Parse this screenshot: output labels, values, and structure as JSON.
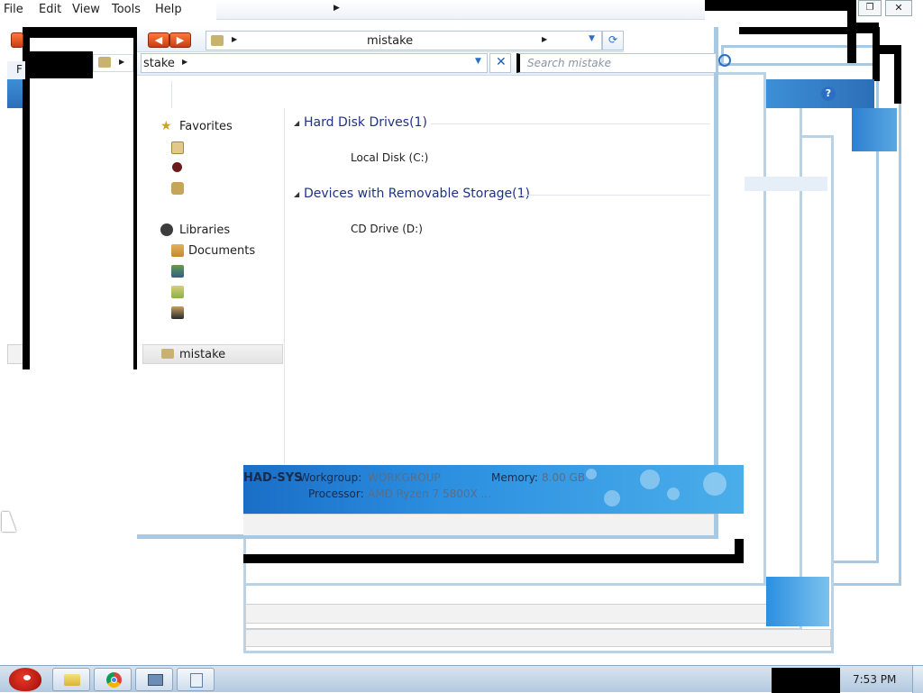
{
  "menu": {
    "file": "File",
    "edit": "Edit",
    "view": "View",
    "tools": "Tools",
    "help": "Help"
  },
  "address": {
    "current": "mistake",
    "back_fragment": "stake",
    "search_placeholder": "Search mistake"
  },
  "navigation": {
    "favorites": "Favorites",
    "libraries": "Libraries",
    "documents": "Documents",
    "computer_item": "mistake"
  },
  "content": {
    "groups": [
      {
        "title": "Hard Disk Drives(1)",
        "items": [
          "Local Disk (C:)"
        ]
      },
      {
        "title": "Devices with Removable Storage(1)",
        "items": [
          "CD Drive (D:)"
        ]
      }
    ]
  },
  "details": {
    "computer_name": "HAD-SYS",
    "workgroup_label": "Workgroup:",
    "workgroup_value": "WORKGROUP",
    "memory_label": "Memory:",
    "memory_value": "8.00 GB",
    "processor_label": "Processor:",
    "processor_value": "AMD Ryzen 7 5800X ..."
  },
  "taskbar": {
    "clock": "7:53 PM"
  },
  "colors": {
    "frame": "#a9c8e2",
    "accent_blue": "#1e3287",
    "details_blue": "#1a6ec6",
    "nav_button": "#e85a1c"
  },
  "icons": [
    "back-arrow-icon",
    "forward-arrow-icon",
    "computer-icon",
    "refresh-icon",
    "close-icon",
    "search-icon",
    "help-icon",
    "star-icon",
    "library-icon",
    "folder-icon",
    "chrome-icon",
    "angry-bird-start-icon"
  ]
}
